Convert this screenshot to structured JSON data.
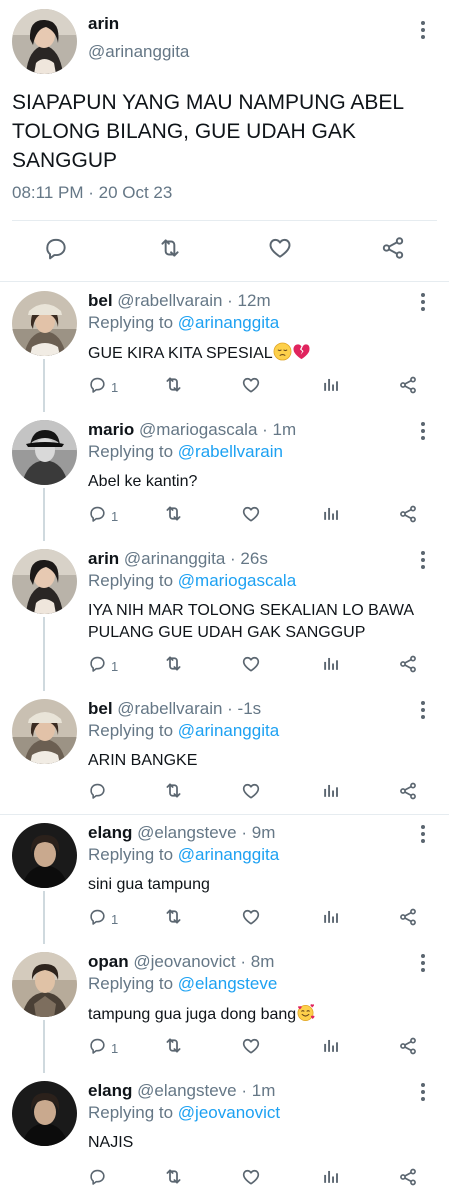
{
  "main_tweet": {
    "name": "arin",
    "handle": "@arinanggita",
    "text": "SIAPAPUN YANG MAU NAMPUNG ABEL TOLONG BILANG, GUE UDAH GAK SANGGUP",
    "timestamp": "08:11 PM · 20 Oct 23"
  },
  "replies": [
    {
      "name": "bel",
      "handle": "@rabellvarain",
      "time": "· 12m",
      "replying_label": "Replying to",
      "replying_to": "@arinanggita",
      "text": "GUE KIRA KITA SPESIAL",
      "emoji": [
        "pensive-face",
        "broken-heart"
      ],
      "reply_count": "1"
    },
    {
      "name": "mario",
      "handle": "@mariogascala",
      "time": "· 1m",
      "replying_label": "Replying to",
      "replying_to": "@rabellvarain",
      "text": "Abel ke kantin?",
      "reply_count": "1"
    },
    {
      "name": "arin",
      "handle": "@arinanggita",
      "time": "· 26s",
      "replying_label": "Replying to",
      "replying_to": "@mariogascala",
      "text": "IYA NIH MAR TOLONG SEKALIAN LO BAWA PULANG GUE UDAH GAK SANGGUP",
      "reply_count": "1"
    },
    {
      "name": "bel",
      "handle": "@rabellvarain",
      "time": "· -1s",
      "replying_label": "Replying to",
      "replying_to": "@arinanggita",
      "text": "ARIN BANGKE",
      "reply_count": ""
    },
    {
      "name": "elang",
      "handle": "@elangsteve",
      "time": "· 9m",
      "replying_label": "Replying to",
      "replying_to": "@arinanggita",
      "text": "sini gua tampung",
      "reply_count": "1"
    },
    {
      "name": "opan",
      "handle": "@jeovanovict",
      "time": "· 8m",
      "replying_label": "Replying to",
      "replying_to": "@elangsteve",
      "text": "tampung gua juga dong bang",
      "emoji": [
        "smiling-face-with-hearts"
      ],
      "reply_count": "1"
    },
    {
      "name": "elang",
      "handle": "@elangsteve",
      "time": "· 1m",
      "replying_label": "Replying to",
      "replying_to": "@jeovanovict",
      "text": "NAJIS",
      "reply_count": ""
    }
  ],
  "icons": {
    "reply": "reply-icon",
    "retweet": "retweet-icon",
    "like": "heart-icon",
    "share": "share-icon",
    "analytics": "analytics-icon",
    "more": "more-icon"
  },
  "colors": {
    "link": "#1da1f2",
    "secondary_text": "#657786",
    "icon": "#5b6670",
    "divider": "#e6ecf0"
  }
}
